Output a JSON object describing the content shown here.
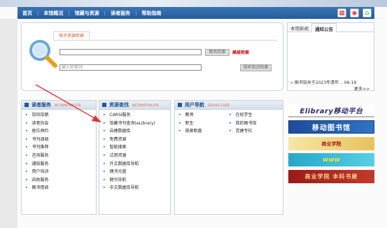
{
  "nav": {
    "items": [
      "首页",
      "本馆概况",
      "馆藏与资源",
      "读者服务",
      "帮助指南"
    ]
  },
  "search": {
    "tab_label": "电子资源检索",
    "kw_value": "",
    "kw_button": "题名检索",
    "advanced_link": "高级检索",
    "quick_placeholder": "输入检索词",
    "quick_button": "视听知识检索"
  },
  "news": {
    "tabs": [
      "本馆新闻",
      "通知公告"
    ],
    "item_text": "图书馆关于2023年清年... 06-19",
    "more": "更多>>"
  },
  "reader": {
    "title": "读者服务",
    "eng": "INFORMATION FOR",
    "items": [
      "馆风馆貌",
      "读者协会",
      "座位预约",
      "书刊调阅",
      "书刊推荐",
      "咨询服务",
      "通知服务",
      "用户培训",
      "自助服务",
      "图书借阅"
    ]
  },
  "resource": {
    "title": "资源查找",
    "eng": "INFORMATION FOR",
    "items": [
      "CARSI服务",
      "馆藏书刊查询(eLibrary)",
      "自建数据库",
      "免费资源",
      "智能搜索",
      "试用资源",
      "外文数据库导航",
      "随书光盘",
      "期刊导航",
      "中文数据库导航"
    ]
  },
  "guide": {
    "title": "用户导航",
    "eng": "SERVICE GUIDE",
    "col1": [
      "教师",
      "新生",
      "规章制度"
    ],
    "col2": [
      "在校学生",
      "我的图书馆",
      "党建专栏"
    ]
  },
  "banners": {
    "b1": "Elibrary移动平台",
    "b2": "移动图书馆",
    "b3": "商业学院",
    "b4": "www",
    "b5": "商业学院 本科书屋"
  },
  "colors": {
    "nav_bg": "#2f6bb0",
    "accent": "#d3541b",
    "link_blue": "#1f4d8d",
    "arrow_red": "#e53030"
  }
}
